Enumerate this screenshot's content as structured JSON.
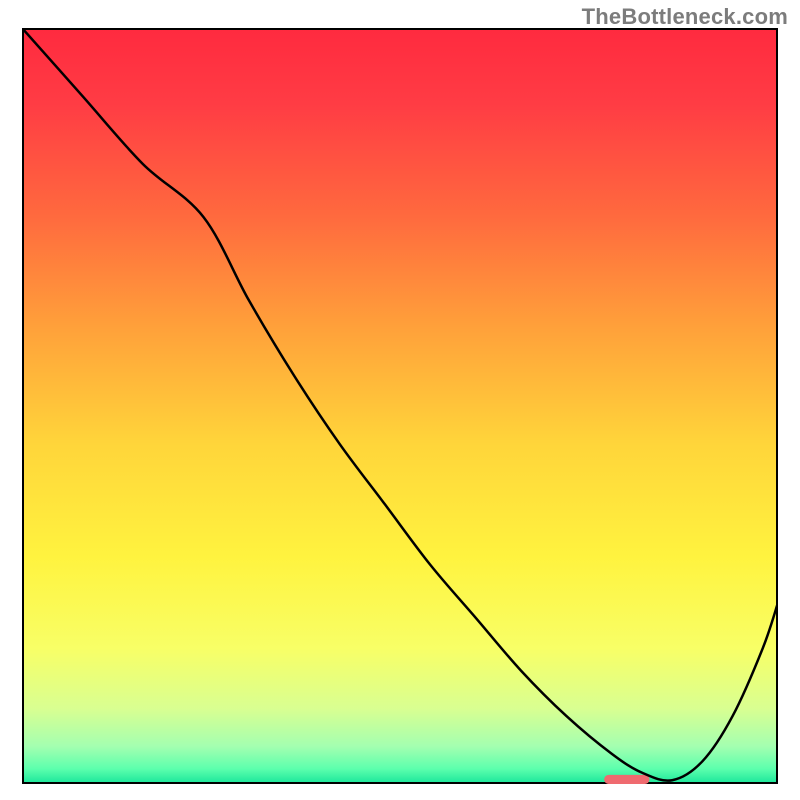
{
  "watermark": "TheBottleneck.com",
  "chart_data": {
    "type": "line",
    "title": "",
    "xlabel": "",
    "ylabel": "",
    "xlim": [
      0,
      100
    ],
    "ylim": [
      0,
      100
    ],
    "grid": false,
    "series": [
      {
        "name": "curve",
        "x": [
          0,
          8,
          16,
          24,
          30,
          36,
          42,
          48,
          54,
          60,
          66,
          72,
          78,
          82,
          86,
          90,
          94,
          98,
          100
        ],
        "values": [
          100,
          91,
          82,
          75,
          64,
          54,
          45,
          37,
          29,
          22,
          15,
          9,
          4,
          1.5,
          0.5,
          3,
          9,
          18,
          24
        ]
      }
    ],
    "marker": {
      "x": 80,
      "y": 0.6,
      "width": 6,
      "height": 1.2,
      "color": "#ef6a6f"
    },
    "background_gradient": {
      "stops": [
        {
          "offset": 0.0,
          "color": "#ff2a3f"
        },
        {
          "offset": 0.1,
          "color": "#ff3c44"
        },
        {
          "offset": 0.25,
          "color": "#ff6a3e"
        },
        {
          "offset": 0.4,
          "color": "#ffa23a"
        },
        {
          "offset": 0.55,
          "color": "#ffd53a"
        },
        {
          "offset": 0.7,
          "color": "#fff33f"
        },
        {
          "offset": 0.82,
          "color": "#f8ff66"
        },
        {
          "offset": 0.9,
          "color": "#d9ff91"
        },
        {
          "offset": 0.95,
          "color": "#a4ffb0"
        },
        {
          "offset": 0.98,
          "color": "#5cffad"
        },
        {
          "offset": 1.0,
          "color": "#18e59a"
        }
      ]
    },
    "frame_color": "#000000",
    "curve_color": "#000000",
    "curve_width": 2.5
  }
}
